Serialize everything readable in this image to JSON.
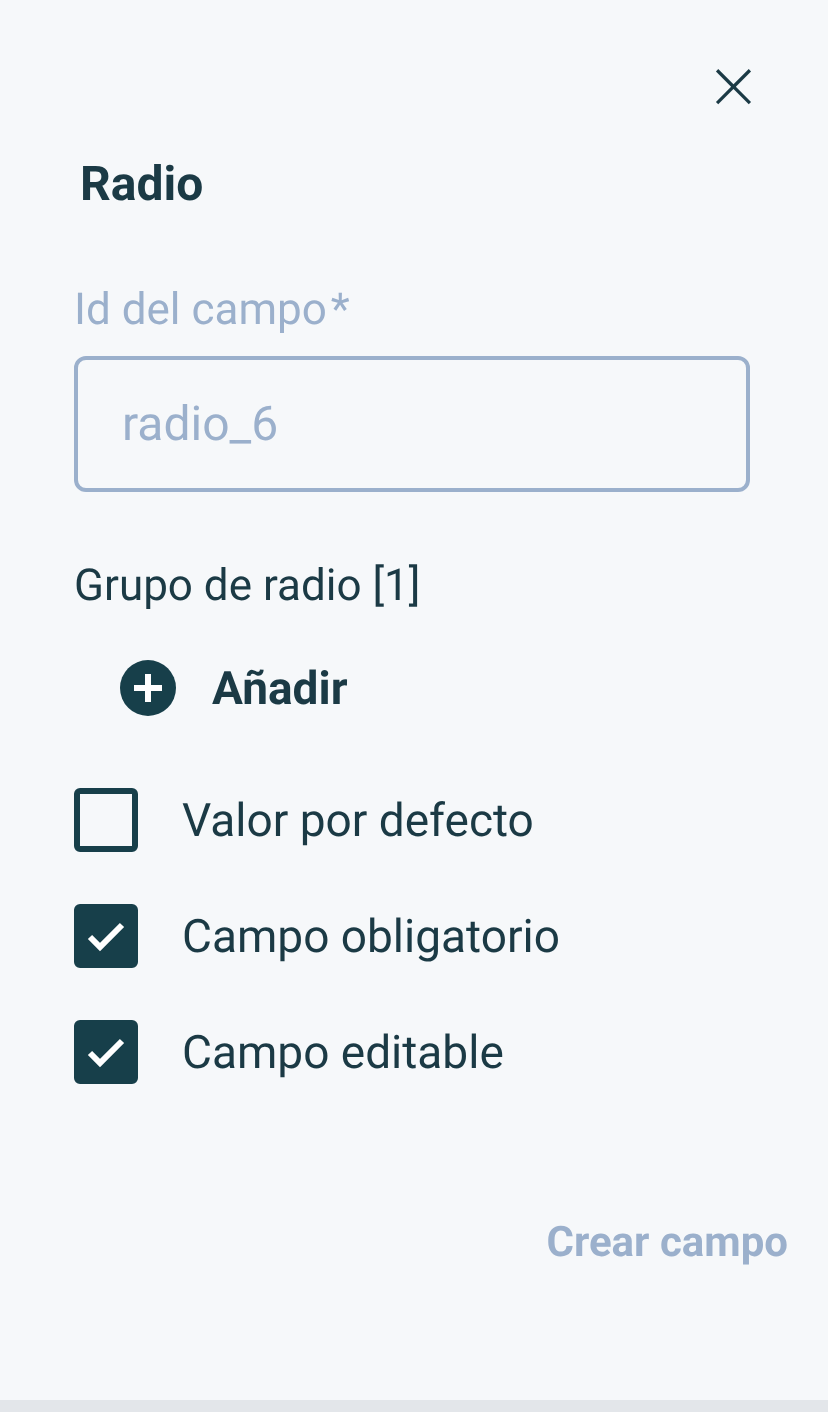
{
  "panel": {
    "title": "Radio",
    "close": "×"
  },
  "field_id": {
    "label": "Id del campo",
    "required_mark": "*",
    "value": "radio_6",
    "disabled": true
  },
  "radio_group": {
    "label": "Grupo de radio [1]",
    "add_button": "Añadir"
  },
  "options": [
    {
      "label": "Valor por defecto",
      "checked": false
    },
    {
      "label": "Campo obligatorio",
      "checked": true
    },
    {
      "label": "Campo editable",
      "checked": true
    }
  ],
  "submit": {
    "label": "Crear campo",
    "disabled": true
  }
}
